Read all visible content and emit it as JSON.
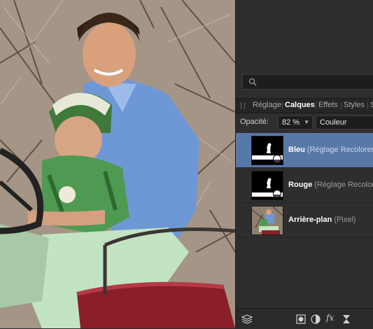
{
  "search": {
    "placeholder": ""
  },
  "tabs": [
    {
      "label": "Réglage",
      "active": false
    },
    {
      "label": "Calques",
      "active": true
    },
    {
      "label": "Effets",
      "active": false
    },
    {
      "label": "Styles",
      "active": false
    },
    {
      "label": "S",
      "active": false
    }
  ],
  "opacity": {
    "label": "Opacité:",
    "value": "82 %"
  },
  "blend_mode": {
    "value": "Couleur"
  },
  "layers": [
    {
      "name": "Bleu",
      "type": "(Réglage Recolorer)",
      "selected": true
    },
    {
      "name": "Rouge",
      "type": "(Réglage Recolorer)",
      "selected": false
    },
    {
      "name": "Arrière-plan",
      "type": "(Pixel)",
      "selected": false
    }
  ],
  "bottom_bar": {
    "icons": [
      "layers-stack-icon",
      "mask-icon",
      "adjustment-icon",
      "fx-icon",
      "hourglass-icon"
    ],
    "fx_label": "fx"
  },
  "colors": {
    "selected_row": "#5878a8",
    "panel_bg": "#2e2e2e"
  }
}
